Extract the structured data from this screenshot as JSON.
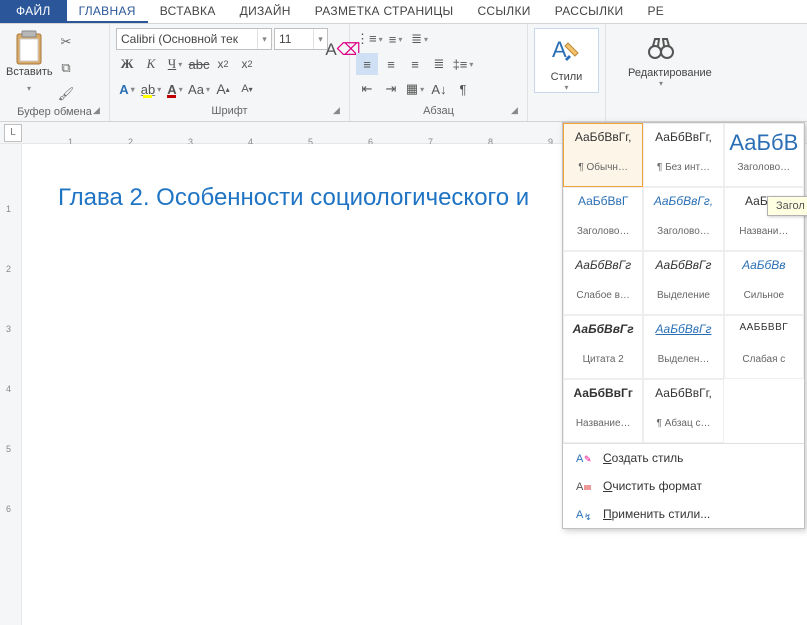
{
  "tabs": {
    "file": "ФАЙЛ",
    "items": [
      "ГЛАВНАЯ",
      "ВСТАВКА",
      "ДИЗАЙН",
      "РАЗМЕТКА СТРАНИЦЫ",
      "ССЫЛКИ",
      "РАССЫЛКИ",
      "РЕ"
    ]
  },
  "groups": {
    "clipboard": {
      "label": "Буфер обмена",
      "paste": "Вставить"
    },
    "font": {
      "label": "Шрифт",
      "name": "Calibri (Основной тек",
      "size": "11"
    },
    "paragraph": {
      "label": "Абзац"
    },
    "styles": {
      "label": "Стили"
    },
    "editing": {
      "label": "Редактирование"
    }
  },
  "ruler": {
    "el": "L",
    "nums": [
      "1",
      "2",
      "3",
      "4",
      "5",
      "6",
      "7",
      "8",
      "9"
    ]
  },
  "vruler": [
    "1",
    "2",
    "3",
    "4",
    "5",
    "6"
  ],
  "doc": {
    "heading": "Глава 2. Особенности социологического и"
  },
  "styles_gallery": [
    {
      "prev": "АаБбВвГг,",
      "name": "¶ Обычн…",
      "cls": "sel"
    },
    {
      "prev": "АаБбВвГг,",
      "name": "¶ Без инт…",
      "cls": ""
    },
    {
      "prev": "АаБбВ",
      "name": "Заголово…",
      "cls": "big"
    },
    {
      "prev": "АаБбВвГ",
      "name": "Заголово…",
      "cls": "blue"
    },
    {
      "prev": "АаБбВвГг,",
      "name": "Заголово…",
      "cls": "blue italic"
    },
    {
      "prev": "АаБбВ",
      "name": "Названи…",
      "cls": ""
    },
    {
      "prev": "АаБбВвГг",
      "name": "Слабое в…",
      "cls": "italic"
    },
    {
      "prev": "АаБбВвГг",
      "name": "Выделение",
      "cls": "italic"
    },
    {
      "prev": "АаБбВв",
      "name": "Сильное",
      "cls": "blue italic"
    },
    {
      "prev": "АаБбВвГг",
      "name": "Цитата 2",
      "cls": "bolditalic"
    },
    {
      "prev": "АаБбВвГг",
      "name": "Выделен…",
      "cls": "blue italic uline"
    },
    {
      "prev": "ААББВВГ",
      "name": "Слабая с",
      "cls": "caps"
    },
    {
      "prev": "АаБбВвГг",
      "name": "Название…",
      "cls": "bold"
    },
    {
      "prev": "АаБбВвГг,",
      "name": "¶ Абзац с…",
      "cls": ""
    }
  ],
  "styles_menu": [
    {
      "icon": "create",
      "label_pre": "",
      "u": "С",
      "label_post": "оздать стиль"
    },
    {
      "icon": "clear",
      "label_pre": "",
      "u": "О",
      "label_post": "чистить формат"
    },
    {
      "icon": "apply",
      "label_pre": "",
      "u": "П",
      "label_post": "рименить стили..."
    }
  ],
  "tooltip": "Загол",
  "colors": {
    "highlight": "#ffff00",
    "fontcolor": "#c00000",
    "accent": "#2b579a"
  }
}
